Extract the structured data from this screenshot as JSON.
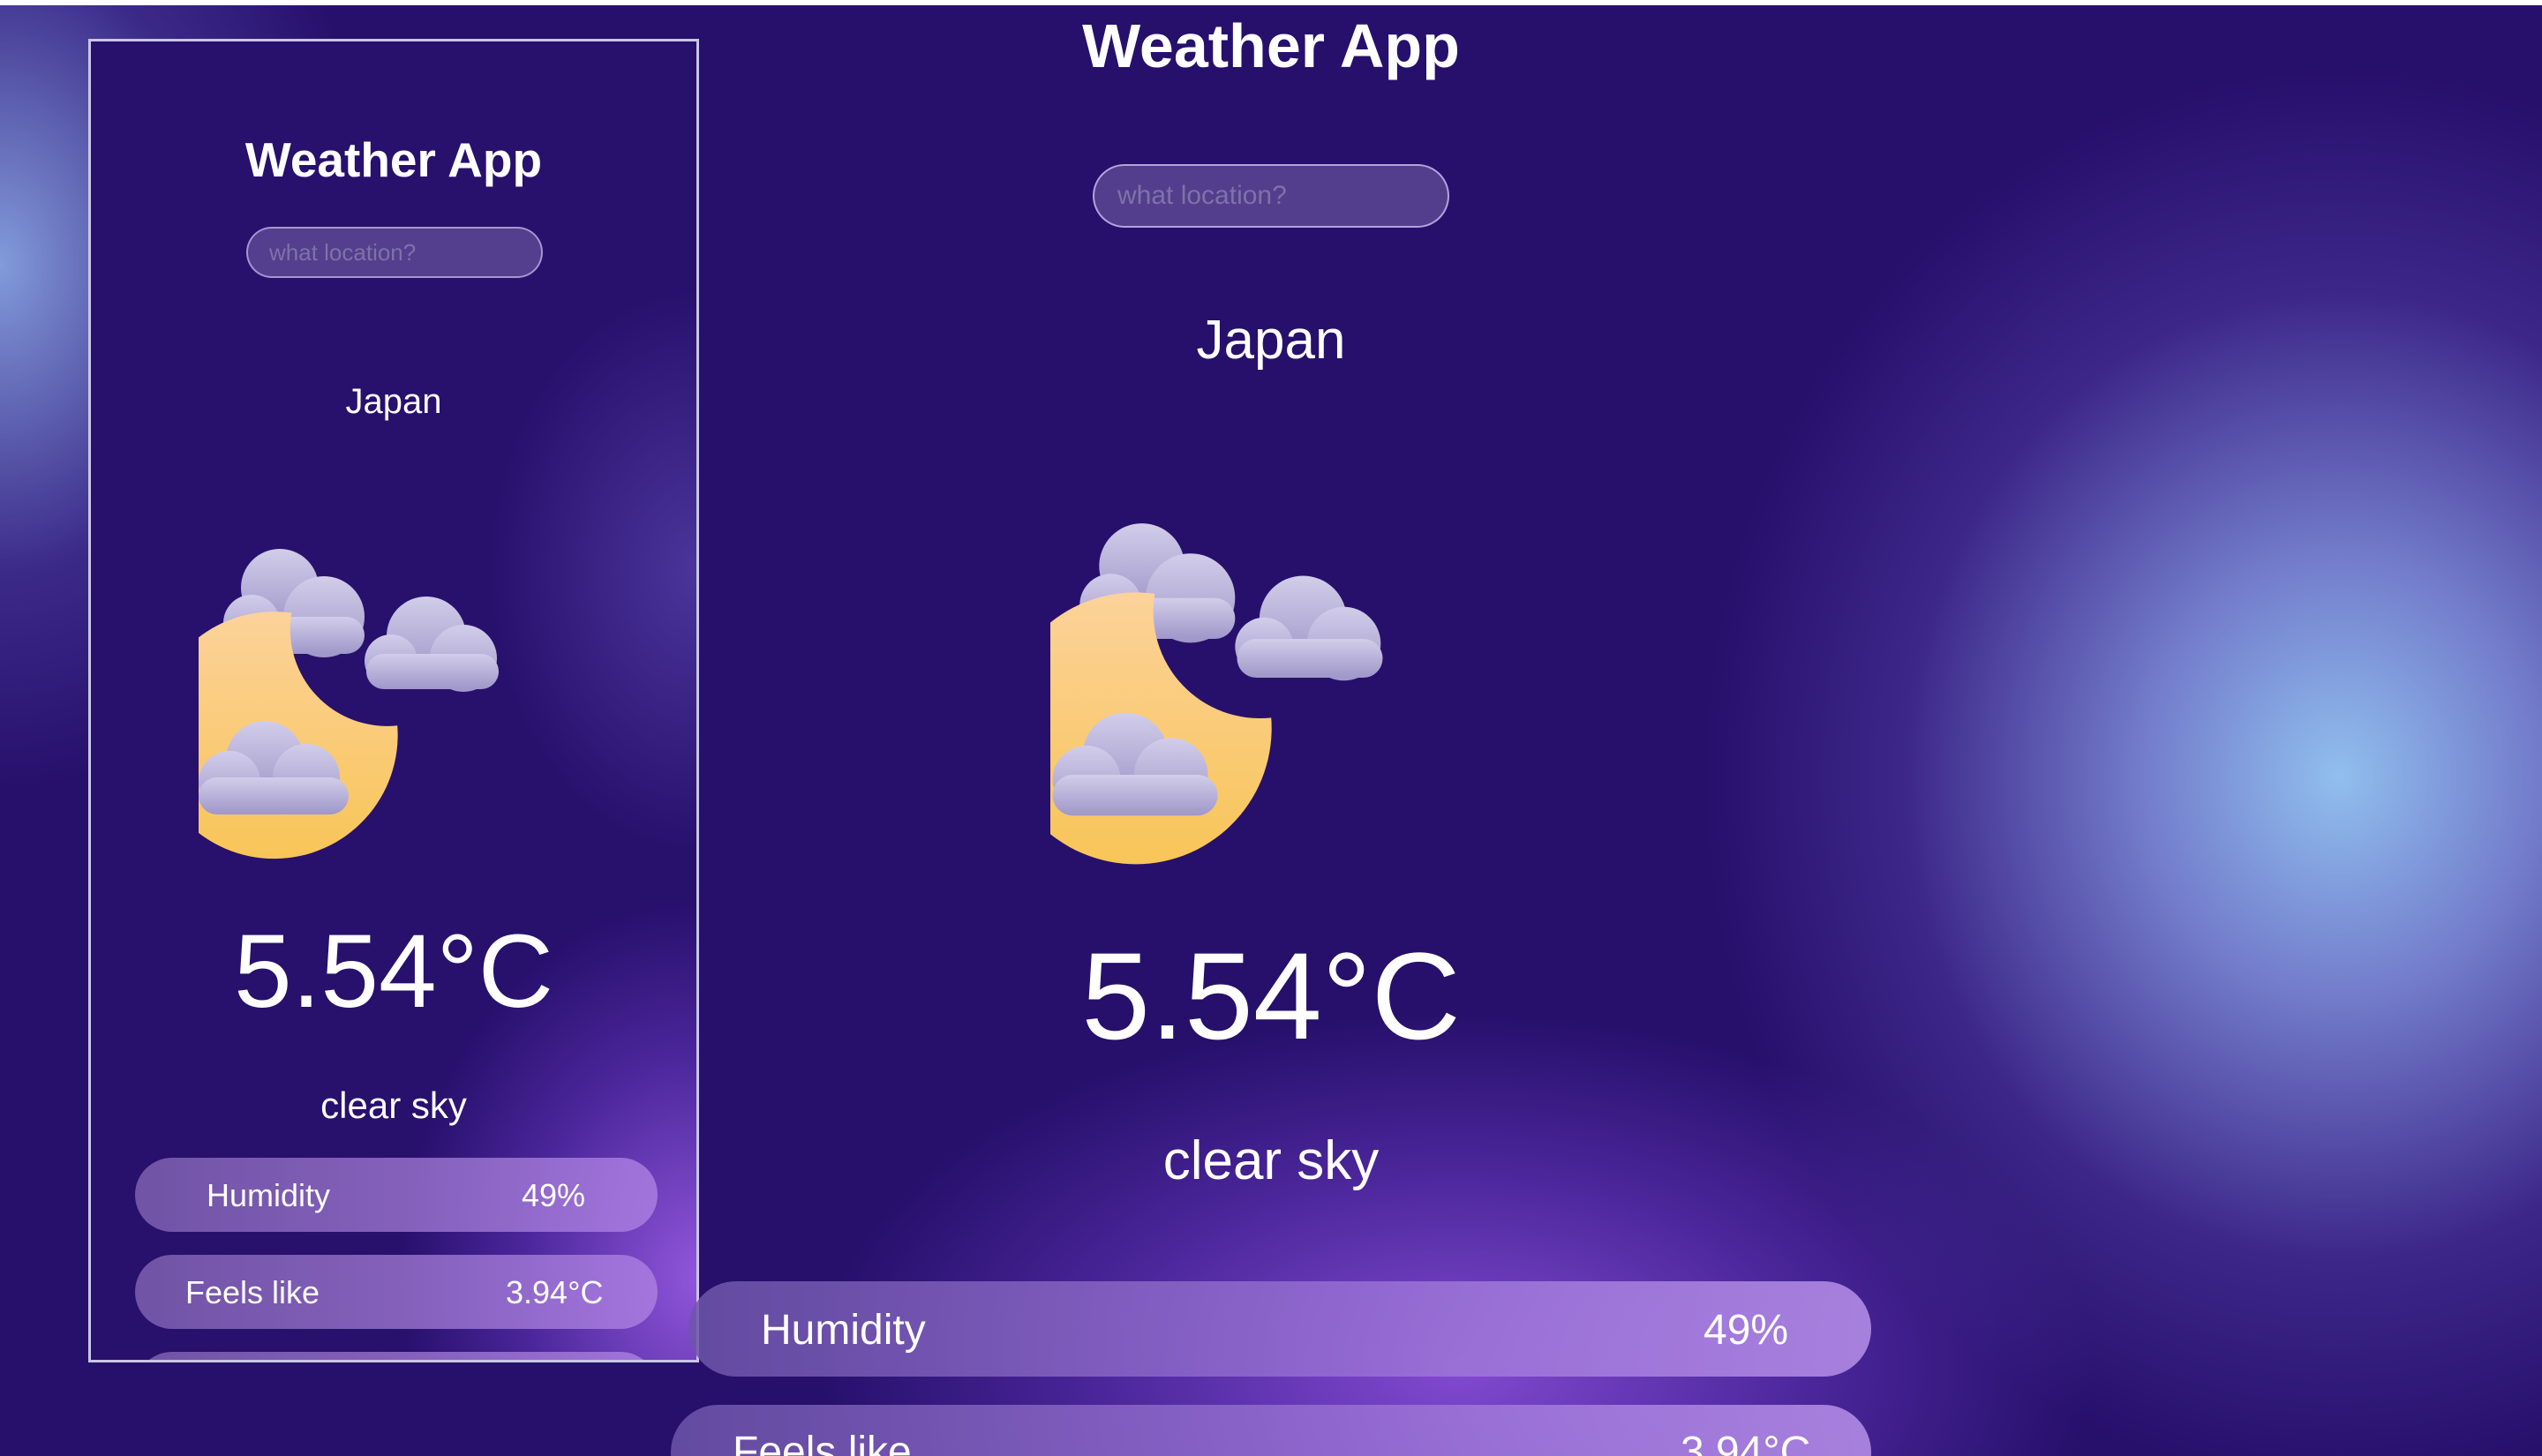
{
  "preview": {
    "title": "Weather App",
    "search_placeholder": "what location?",
    "location": "Japan",
    "weather_icon": "moon-clouds-icon",
    "temperature": "5.54°C",
    "description": "clear sky",
    "stats": [
      {
        "label": "Humidity",
        "value": "49%"
      },
      {
        "label": "Feels like",
        "value": "3.94°C"
      }
    ]
  },
  "main": {
    "title": "Weather App",
    "search_placeholder": "what location?",
    "location": "Japan",
    "weather_icon": "moon-clouds-icon",
    "temperature": "5.54°C",
    "description": "clear sky",
    "stats": [
      {
        "label": "Humidity",
        "value": "49%"
      },
      {
        "label": "Feels like",
        "value": "3.94°C"
      }
    ]
  },
  "colors": {
    "background": "#27106c",
    "moon": "#f9c86d",
    "cloud": "#b8b0dc",
    "text": "#ffffff"
  }
}
